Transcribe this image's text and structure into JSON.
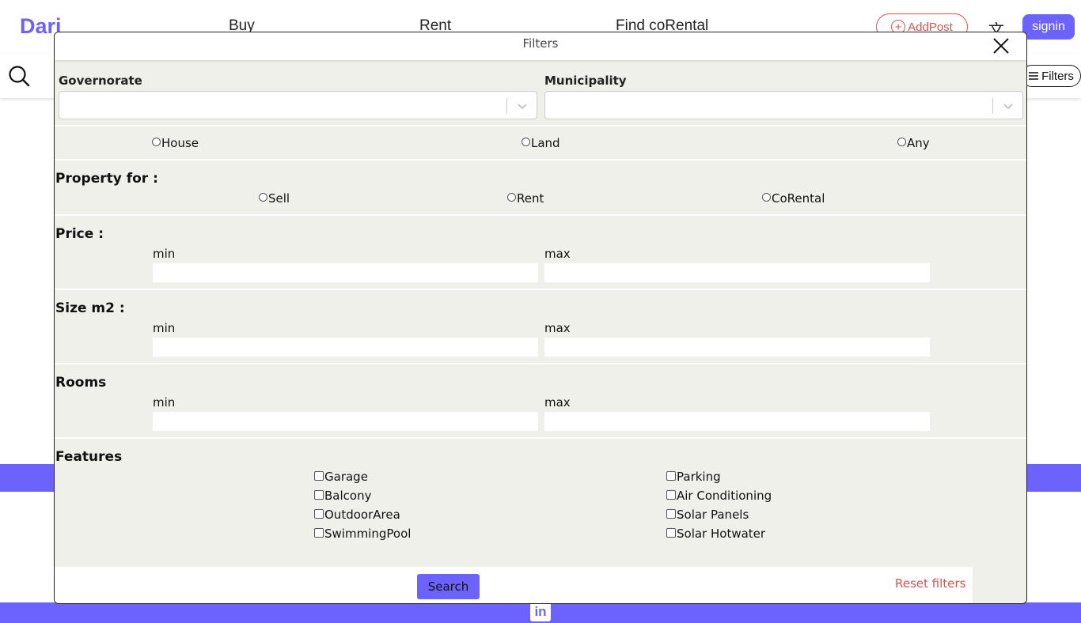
{
  "nav": {
    "brand": "Dari",
    "links": [
      "Buy",
      "Rent",
      "Find coRental"
    ],
    "add_post": "AddPost",
    "signin": "signin",
    "accent_color": "#6c63ff",
    "danger_color": "#d9534f"
  },
  "toolbar": {
    "filters_label": "Filters"
  },
  "modal": {
    "title": "Filters",
    "governorate": {
      "label": "Governorate",
      "value": ""
    },
    "municipality": {
      "label": "Municipality",
      "value": ""
    },
    "property_type": {
      "options": [
        "House",
        "Land",
        "Any"
      ],
      "selected": null
    },
    "property_for": {
      "label": "Property for :",
      "options": [
        "Sell",
        "Rent",
        "CoRental"
      ],
      "selected": null
    },
    "price": {
      "label": "Price :",
      "min_label": "min",
      "max_label": "max",
      "min": "",
      "max": ""
    },
    "size": {
      "label": "Size m2 :",
      "min_label": "min",
      "max_label": "max",
      "min": "",
      "max": ""
    },
    "rooms": {
      "label": "Rooms",
      "min_label": "min",
      "max_label": "max",
      "min": "",
      "max": ""
    },
    "features": {
      "label": "Features",
      "left": [
        "Garage",
        "Balcony",
        "OutdoorArea",
        "SwimmingPool"
      ],
      "right": [
        "Parking",
        "Air Conditioning",
        "Solar Panels",
        "Solar Hotwater"
      ]
    },
    "search_button": "Search",
    "reset_link": "Reset filters"
  },
  "footer": {
    "social_icon": "in"
  }
}
